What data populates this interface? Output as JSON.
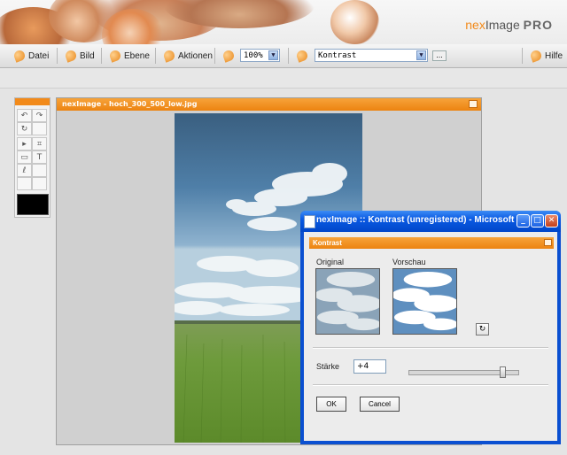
{
  "app": {
    "logo_prefix": "nex",
    "logo_main": "Image",
    "logo_suffix": "PRO"
  },
  "menu": {
    "file": "Datei",
    "image": "Bild",
    "layer": "Ebene",
    "actions": "Aktionen",
    "zoom_value": "100%",
    "filter_value": "Kontrast",
    "more_label": "...",
    "help": "Hilfe"
  },
  "image_window": {
    "title": "nexImage - hoch_300_500_low.jpg"
  },
  "dialog": {
    "window_title": "nexImage :: Kontrast (unregistered) - Microsoft I...",
    "panel_title": "Kontrast",
    "original_label": "Original",
    "preview_label": "Vorschau",
    "strength_label": "Stärke",
    "strength_value": "+4",
    "strength_slider_fraction": 0.88,
    "ok_label": "OK",
    "cancel_label": "Cancel"
  },
  "icons": {
    "menu": "orange-swirl-icon",
    "refresh": "refresh-icon",
    "tools": [
      "undo-icon",
      "redo-icon",
      "rotate-icon",
      "move-icon",
      "crop-icon",
      "select-icon",
      "text-icon",
      "lasso-icon"
    ]
  },
  "colors": {
    "accent": "#ec8310",
    "xp_title": "#0a5ae3",
    "foreground_color": "#000000"
  }
}
